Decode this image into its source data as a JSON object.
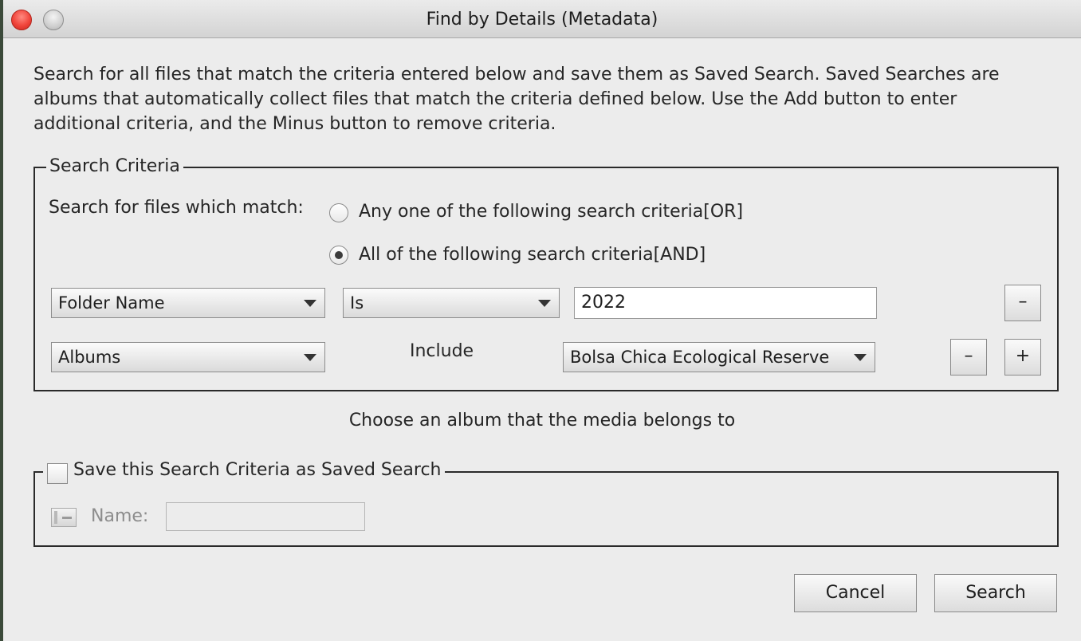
{
  "window": {
    "title": "Find by Details (Metadata)"
  },
  "description": "Search for all files that match the criteria entered below and save them as Saved Search. Saved Searches are albums that automatically collect files that match the criteria defined below. Use the Add button to enter additional criteria, and the Minus button to remove criteria.",
  "criteria": {
    "legend": "Search Criteria",
    "match_label": "Search for files which match:",
    "option_or": "Any one of the following search criteria[OR]",
    "option_and": "All of the following search criteria[AND]",
    "selected_option": "and",
    "rows": [
      {
        "field": "Folder Name",
        "operator": "Is",
        "value": "2022",
        "remove": "–"
      },
      {
        "field": "Albums",
        "operator": "Include",
        "value": "Bolsa Chica Ecological Reserve",
        "remove": "–",
        "add": "+"
      }
    ]
  },
  "hint": "Choose an album that the media belongs to",
  "saved_search": {
    "label": "Save this Search Criteria as Saved Search",
    "checked": false,
    "name_label": "Name:",
    "name_value": ""
  },
  "buttons": {
    "cancel": "Cancel",
    "search": "Search"
  },
  "colors": {
    "close": "#f0453b",
    "background": "#ececec"
  }
}
